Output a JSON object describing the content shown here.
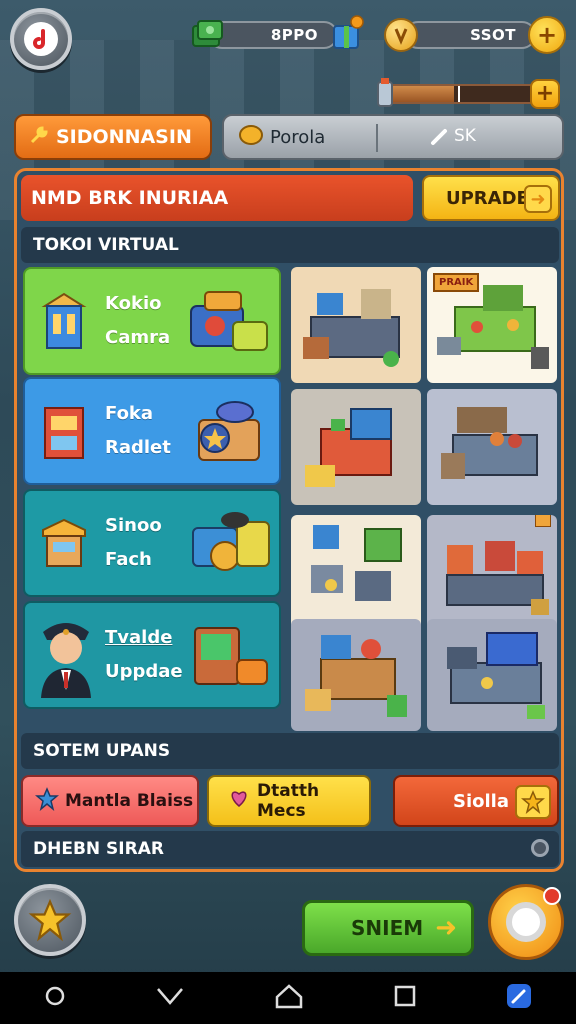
{
  "topbar": {
    "cash_value": "8PPO",
    "gold_value": "SSOT"
  },
  "tabs": {
    "active": "SIDONNASIN",
    "second": "Porola",
    "second_tail": "SK"
  },
  "panel": {
    "title": "NMD BRK INURIAA",
    "upgrade_label": "UPRADE",
    "section_top": "TOKOI VIRTUAL",
    "section_bottom": "SOTEM UPANS",
    "footer": "DHEBN SIRAR"
  },
  "categories": [
    {
      "line1": "Kokio",
      "line2": "Camra",
      "color": "#7fd64a"
    },
    {
      "line1": "Foka",
      "line2": "Radlet",
      "color": "#3d9ae6"
    },
    {
      "line1": "Sinoo",
      "line2": "Fach",
      "color": "#1e9aa5"
    },
    {
      "line1": "Tvalde",
      "line2": "Uppdae",
      "color": "#1f97a3"
    }
  ],
  "tiles": {
    "badge_text": "PRAIK"
  },
  "bottom_buttons": {
    "left": "Mantla Blaiss",
    "middle": "Dtatth Mecs",
    "right": "Siolla"
  },
  "footer_actions": {
    "go_label": "SNIEM"
  },
  "colors": {
    "accent_orange": "#e9832f",
    "upgrade_yellow": "#f4b414",
    "go_green": "#5bbf2c",
    "title_red": "#d6472a"
  },
  "icons": [
    "music-app-icon",
    "cash-stack-icon",
    "gift-box-icon",
    "gold-coin-icon",
    "plus-icon",
    "star-icon",
    "wrench-icon",
    "arrow-right-icon",
    "gear-icon",
    "back-nav-icon",
    "home-nav-icon",
    "recent-nav-icon"
  ]
}
